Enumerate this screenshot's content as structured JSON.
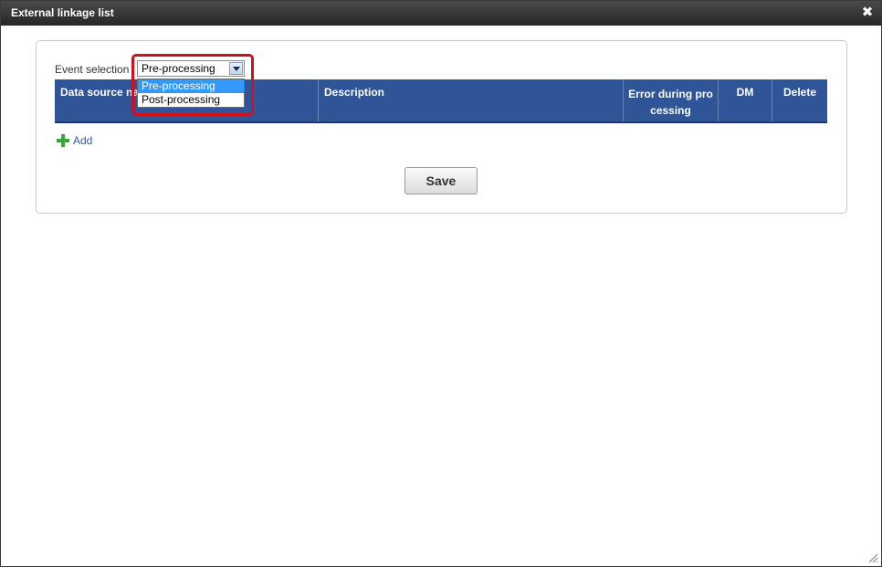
{
  "dialog": {
    "title": "External linkage list",
    "close_label": "✖"
  },
  "event_selection": {
    "label": "Event selection",
    "selected_value": "Pre-processing",
    "options": [
      "Pre-processing",
      "Post-processing"
    ]
  },
  "table": {
    "columns": [
      "Data source na",
      "Description",
      "Error during pro",
      "cessing",
      "DM",
      "Delete"
    ]
  },
  "actions": {
    "add_label": "Add",
    "save_label": "Save"
  },
  "colors": {
    "header_bg": "#2f5497",
    "highlight": "#cc1122",
    "option_selected": "#3399ff",
    "link": "#2a5db0",
    "add_icon": "#3aa63a"
  }
}
